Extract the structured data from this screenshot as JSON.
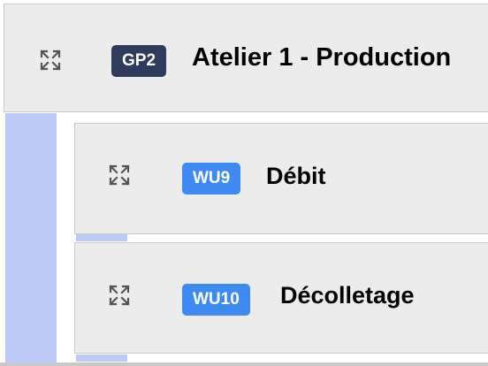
{
  "group": {
    "code": "GP2",
    "title": "Atelier 1 - Production",
    "icon": "expand-icon",
    "badge_color": "#2d3c5c",
    "rail_color": "#bccaf7"
  },
  "units": [
    {
      "code": "WU9",
      "title": "Débit",
      "icon": "expand-icon",
      "badge_color": "#3d8bf2"
    },
    {
      "code": "WU10",
      "title": "Décolletage",
      "icon": "expand-icon",
      "badge_color": "#3d8bf2"
    }
  ]
}
